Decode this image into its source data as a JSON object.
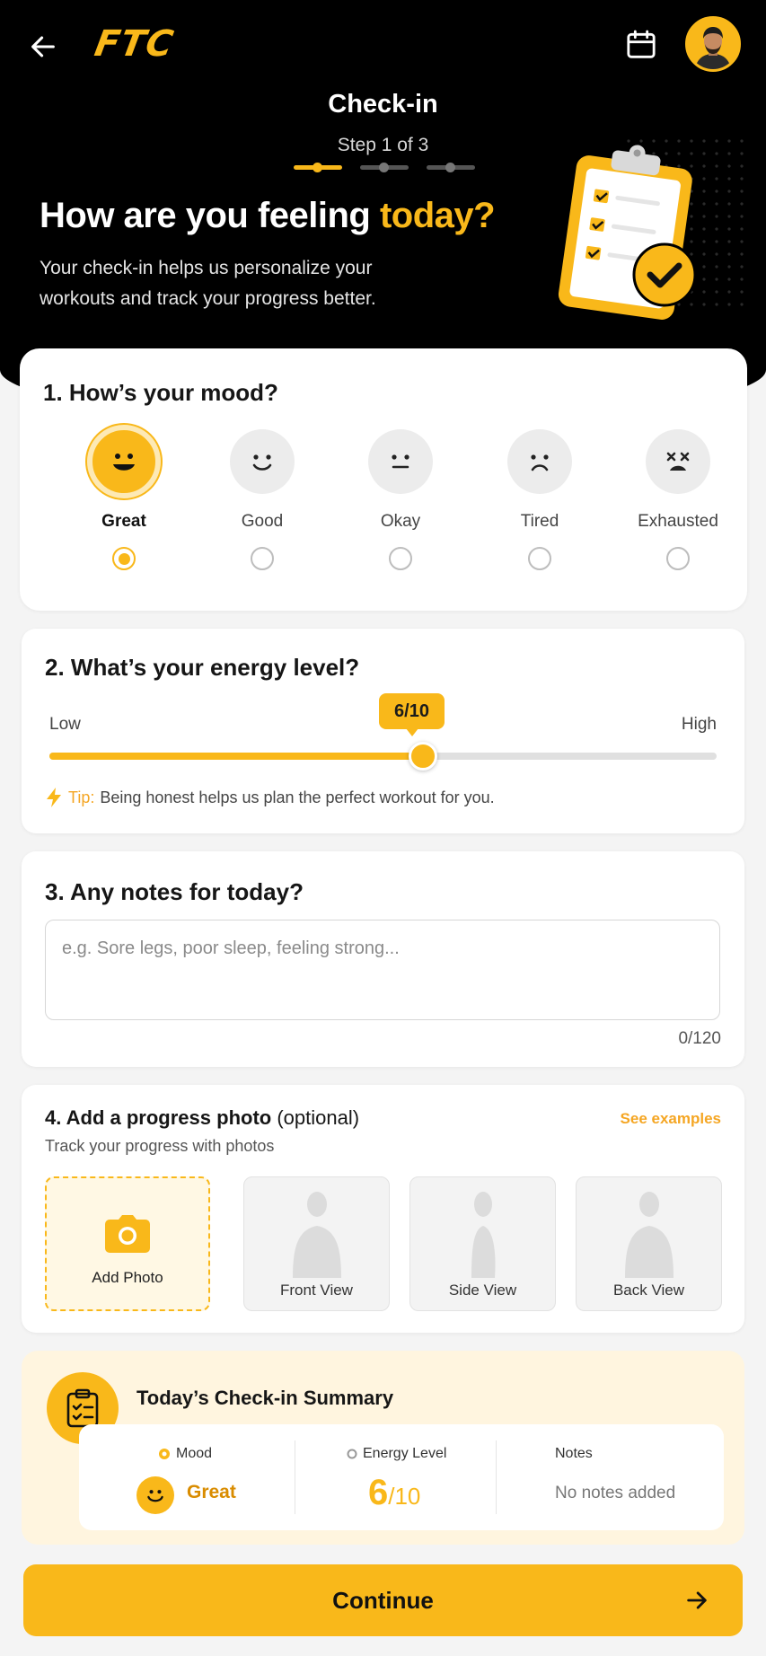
{
  "header": {
    "logo": "FTC",
    "title": "Check-in",
    "step": "Step 1 of 3",
    "headline_main": "How are you feeling ",
    "headline_accent": "today?",
    "subtitle": "Your check-in helps us personalize your workouts and track your progress better."
  },
  "mood": {
    "title": "1. How’s your mood?",
    "options": [
      {
        "label": "Great",
        "icon": "grin-face-icon",
        "selected": true
      },
      {
        "label": "Good",
        "icon": "smile-face-icon",
        "selected": false
      },
      {
        "label": "Okay",
        "icon": "neutral-face-icon",
        "selected": false
      },
      {
        "label": "Tired",
        "icon": "frown-face-icon",
        "selected": false
      },
      {
        "label": "Exhausted",
        "icon": "dizzy-face-icon",
        "selected": false
      }
    ]
  },
  "energy": {
    "title": "2. What’s your energy level?",
    "low_label": "Low",
    "high_label": "High",
    "value_label": "6/10",
    "value": 6,
    "max": 10,
    "tip_key": "Tip:",
    "tip_text": "Being honest helps us plan the perfect workout for you."
  },
  "notes": {
    "title": "3. Any notes for today?",
    "placeholder": "e.g. Sore legs, poor sleep, feeling strong...",
    "counter": "0/120"
  },
  "photo": {
    "title_bold": "4. Add a progress photo",
    "title_optional": " (optional)",
    "see_examples": "See examples",
    "subtitle": "Track your progress with photos",
    "add_label": "Add Photo",
    "views": [
      "Front View",
      "Side View",
      "Back View"
    ]
  },
  "summary": {
    "title": "Today’s Check-in Summary",
    "mood_label": "Mood",
    "mood_value": "Great",
    "energy_label": "Energy Level",
    "energy_value": "6",
    "energy_max": "/10",
    "notes_label": "Notes",
    "notes_value": "No notes added"
  },
  "continue_label": "Continue",
  "colors": {
    "accent": "#f9b81a",
    "background": "#000000",
    "accent_text": "#f5a623"
  }
}
